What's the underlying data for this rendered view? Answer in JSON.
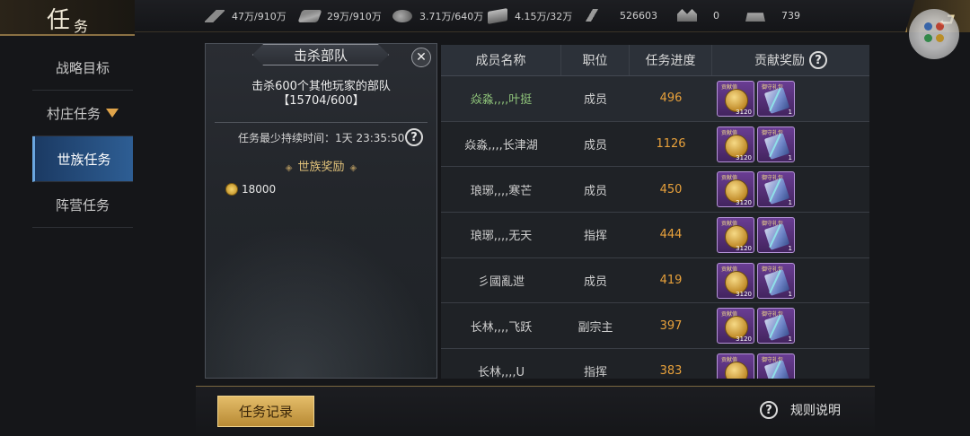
{
  "header": {
    "title_char1": "任",
    "title_char2": "务",
    "resources": [
      {
        "icon": "grain-icon",
        "value": "47万/910万"
      },
      {
        "icon": "wood-icon",
        "value": "29万/910万"
      },
      {
        "icon": "stone-icon",
        "value": "3.71万/640万"
      },
      {
        "icon": "iron-icon",
        "value": "4.15万/32万"
      },
      {
        "icon": "flag-icon",
        "value": "526603"
      },
      {
        "icon": "gold-icon",
        "value": "0"
      },
      {
        "icon": "silver-icon",
        "value": "739"
      }
    ],
    "back_icon": "back-arrow-icon"
  },
  "sidebar": {
    "items": [
      {
        "label": "战略目标"
      },
      {
        "label": "村庄任务"
      },
      {
        "label": "世族任务"
      },
      {
        "label": "阵营任务"
      }
    ]
  },
  "task_panel": {
    "title": "击杀部队",
    "description_line1": "击杀600个其他玩家的部队",
    "description_line2": "【15704/600】",
    "duration": "任务最少持续时间：1天 23:35:50",
    "reward_title": "世族奖励",
    "reward_deco_left": "◈",
    "reward_deco_right": "◈",
    "reward_amount": "18000",
    "close_label": "✕",
    "help_label": "?"
  },
  "table": {
    "headers": [
      "成员名称",
      "职位",
      "任务进度",
      "贡献奖励"
    ],
    "reward_header_help": "?",
    "reward_items": {
      "medal_tag": "贡献值",
      "medal_count": "3120",
      "scroll_tag": "御守礼包",
      "scroll_count": "1"
    },
    "rows": [
      {
        "name": "焱淼,,,,叶挺",
        "role": "成员",
        "progress": "496"
      },
      {
        "name": "焱淼,,,,长津湖",
        "role": "成员",
        "progress": "1126"
      },
      {
        "name": "琅琊,,,,寒芒",
        "role": "成员",
        "progress": "450"
      },
      {
        "name": "琅琊,,,,无天",
        "role": "指挥",
        "progress": "444"
      },
      {
        "name": "彡國亂迣",
        "role": "成员",
        "progress": "419"
      },
      {
        "name": "长林,,,,飞跃",
        "role": "副宗主",
        "progress": "397"
      },
      {
        "name": "长林,,,,U",
        "role": "指挥",
        "progress": "383"
      }
    ]
  },
  "footer": {
    "record_button": "任务记录",
    "rules_help": "?",
    "rules_label": "规则说明"
  }
}
